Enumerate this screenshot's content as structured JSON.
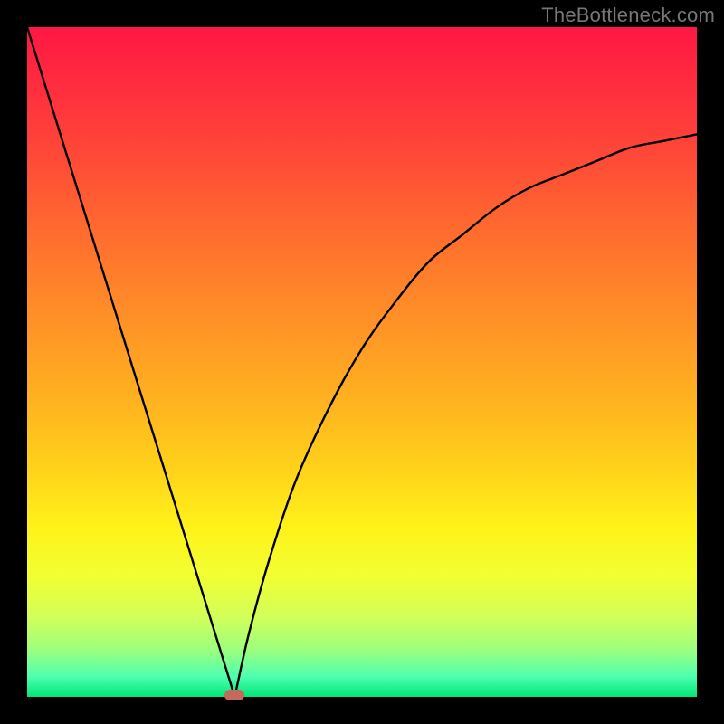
{
  "watermark": "TheBottleneck.com",
  "colors": {
    "frame": "#000000",
    "curve": "#000000",
    "marker": "#c36a5d",
    "gradient_top": "#ff1744",
    "gradient_bottom": "#00e676"
  },
  "chart_data": {
    "type": "line",
    "title": "",
    "xlabel": "",
    "ylabel": "",
    "xlim": [
      0,
      100
    ],
    "ylim": [
      0,
      100
    ],
    "grid": false,
    "legend": false,
    "annotations": [
      "TheBottleneck.com"
    ],
    "marker_point": {
      "x": 31,
      "y": 0
    },
    "series": [
      {
        "name": "left-branch",
        "x": [
          0,
          5,
          10,
          15,
          20,
          25,
          30,
          31
        ],
        "y": [
          100,
          84,
          68,
          52,
          35,
          19,
          3,
          0
        ]
      },
      {
        "name": "right-branch",
        "x": [
          31,
          33,
          36,
          40,
          45,
          50,
          55,
          60,
          65,
          70,
          75,
          80,
          85,
          90,
          95,
          100
        ],
        "y": [
          0,
          9,
          20,
          32,
          43,
          52,
          59,
          65,
          69,
          73,
          76,
          78,
          80,
          82,
          83,
          84
        ]
      }
    ]
  }
}
